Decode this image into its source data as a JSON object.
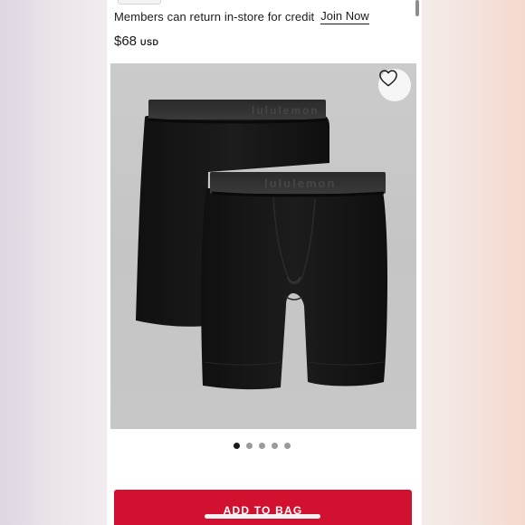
{
  "promo": {
    "text": "Members can return in-store for credit",
    "link": "Join Now"
  },
  "product": {
    "price": "$68",
    "currency": "USD"
  },
  "carousel": {
    "total_images": 5,
    "active_index": 0
  },
  "cta": {
    "add_to_bag": "ADD TO BAG"
  },
  "icons": {
    "wishlist": "heart-icon"
  },
  "colors": {
    "cta_background": "#d2102f",
    "image_background": "#c8c8c8",
    "product": "#141414"
  }
}
